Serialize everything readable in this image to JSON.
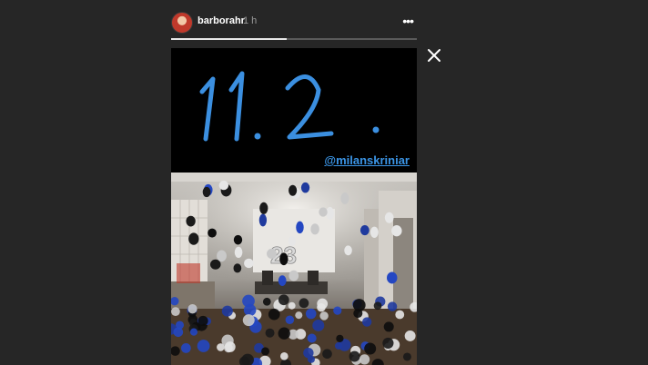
{
  "header": {
    "username": "barborahr",
    "time": "1 h"
  },
  "icons": {
    "more": "more-dots-icon",
    "close": "close-icon",
    "avatar": "profile-avatar"
  },
  "progress": {
    "fraction": 0.47
  },
  "story": {
    "handwritten_text": "11. 2 .",
    "mention": "@milanskriniar",
    "colors": {
      "handwriting": "#3b8fe0",
      "mention": "#3b95e6",
      "background": "#000000"
    }
  }
}
